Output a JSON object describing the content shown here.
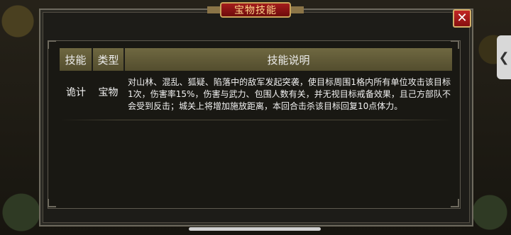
{
  "dialog": {
    "title": "宝物技能",
    "close_symbol": "✕"
  },
  "table": {
    "headers": [
      "技能",
      "类型",
      "技能说明"
    ],
    "rows": [
      {
        "skill": "诡计",
        "type": "宝物",
        "description": "对山林、混乱、狐疑、陷落中的敌军发起突袭，使目标周围1格内所有单位攻击该目标1次，伤害率15%，伤害与武力、包围人数有关，并无视目标戒备效果，且己方部队不会受到反击；城关上将增加施放距离，本回合击杀该目标回复10点体力。"
      }
    ]
  },
  "side_tab": {
    "symbol": "❮"
  },
  "colors": {
    "title_plate": "#8a1414",
    "header_bg": "#625b37",
    "dialog_bg": "#1d1c18",
    "close_button": "#a61b1b"
  }
}
